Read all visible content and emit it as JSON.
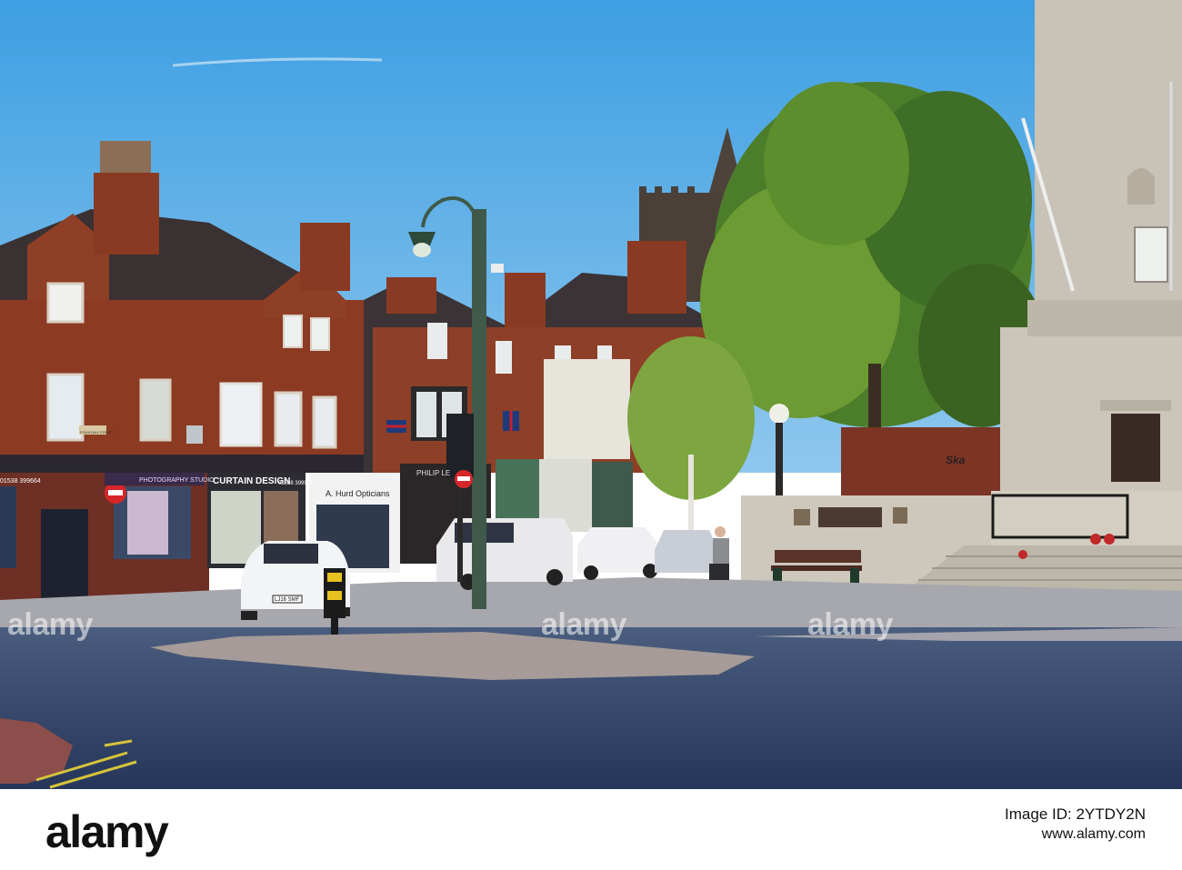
{
  "photo": {
    "scene": "town-square-street",
    "sky_color": "#4aa7e6",
    "signs": {
      "photography_studio": "PHOTOGRAPHY STUDIO",
      "curtain_design": "CURTAIN DESIGN",
      "opticians": "A. Hurd Opticians",
      "philip": "PHILIP LE",
      "phone_left": "01538 399664",
      "phone_right": "01538 399910",
      "fountain_street": "FOUNTAIN STREET",
      "plate": "LJ16 SMF",
      "ska": "Ska"
    },
    "watermarks": [
      "alamy",
      "alamy",
      "alamy"
    ]
  },
  "footer": {
    "logo": "alamy",
    "image_id": "Image ID: 2YTDY2N",
    "site": "www.alamy.com"
  }
}
